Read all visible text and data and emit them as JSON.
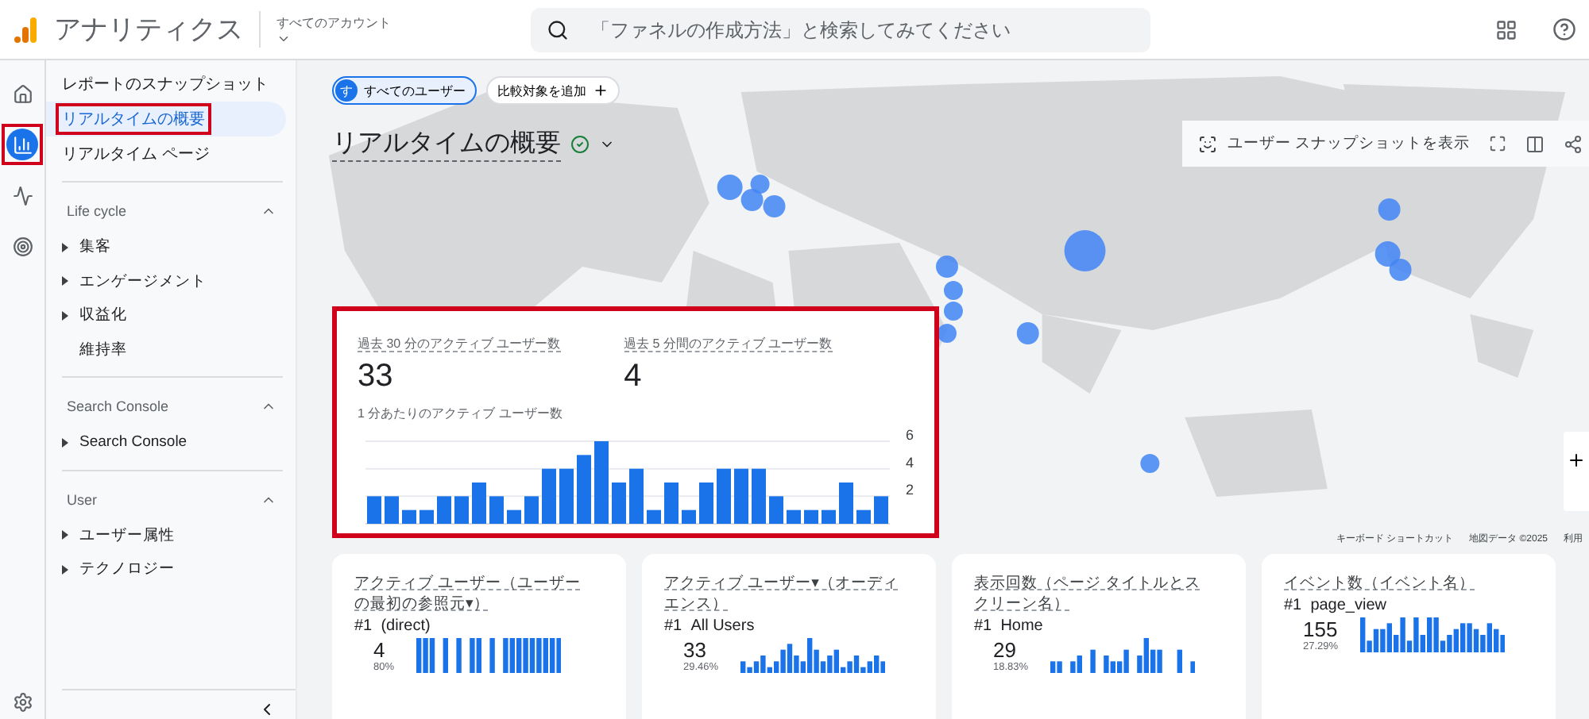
{
  "header": {
    "app_title": "アナリティクス",
    "account_label": "すべてのアカウント",
    "search_placeholder": "「ファネルの作成方法」と検索してみてください"
  },
  "rail": [
    {
      "kind": "home",
      "selected": false,
      "highlighted": false
    },
    {
      "kind": "reports",
      "selected": true,
      "highlighted": true
    },
    {
      "kind": "explore",
      "selected": false,
      "highlighted": false
    },
    {
      "kind": "advertising",
      "selected": false,
      "highlighted": false
    }
  ],
  "nav": {
    "items": [
      {
        "label": "レポートのスナップショット",
        "selected": false,
        "highlighted": false
      },
      {
        "label": "リアルタイムの概要",
        "selected": true,
        "highlighted": true
      },
      {
        "label": "リアルタイム ページ",
        "selected": false,
        "highlighted": false
      }
    ],
    "sections": [
      {
        "title": "Life cycle",
        "expanded": true,
        "items": [
          {
            "label": "集客",
            "has_children": true
          },
          {
            "label": "エンゲージメント",
            "has_children": true
          },
          {
            "label": "収益化",
            "has_children": true
          },
          {
            "label": "維持率",
            "has_children": false
          }
        ]
      },
      {
        "title": "Search Console",
        "expanded": true,
        "items": [
          {
            "label": "Search Console",
            "has_children": true
          }
        ]
      },
      {
        "title": "User",
        "expanded": true,
        "items": [
          {
            "label": "ユーザー属性",
            "has_children": true
          },
          {
            "label": "テクノロジー",
            "has_children": true
          }
        ]
      }
    ]
  },
  "main": {
    "segment": {
      "avatar": "す",
      "label": "すべてのユーザー"
    },
    "compare_label": "比較対象を追加",
    "title": "リアルタイムの概要",
    "snapshot_button": "ユーザー スナップショットを表示"
  },
  "overview": {
    "highlighted": true,
    "metrics": [
      {
        "label": "過去 30 分のアクティブ ユーザー数",
        "value": "33"
      },
      {
        "label": "過去 5 分間のアクティブ ユーザー数",
        "value": "4"
      }
    ],
    "chart_data": {
      "type": "bar",
      "title": "1 分あたりのアクティブ ユーザー数",
      "yticks": [
        2,
        4,
        6
      ],
      "ylim": [
        0,
        6
      ],
      "values": [
        2,
        2,
        1,
        1,
        2,
        2,
        3,
        2,
        1,
        2,
        4,
        4,
        5,
        6,
        3,
        4,
        1,
        3,
        1,
        3,
        4,
        4,
        4,
        2,
        1,
        1,
        1,
        3,
        1,
        2
      ]
    }
  },
  "map_attribution": [
    "キーボード ショートカット",
    "地図データ ©2025",
    "利用"
  ],
  "cards": [
    {
      "title": "アクティブ ユーザー（ユーザーの最初の参照元▾）",
      "rank": "#1",
      "name": "(direct)",
      "value": "4",
      "percent": "80%"
    },
    {
      "title": "アクティブ ユーザー▾（オーディエンス）",
      "rank": "#1",
      "name": "All Users",
      "value": "33",
      "percent": "29.46%"
    },
    {
      "title": "表示回数（ページ タイトルとスクリーン名）",
      "rank": "#1",
      "name": "Home",
      "value": "29",
      "percent": "18.83%"
    },
    {
      "title": "イベント数（イベント名）",
      "rank": "#1",
      "name": "page_view",
      "value": "155",
      "percent": "27.29%"
    }
  ]
}
